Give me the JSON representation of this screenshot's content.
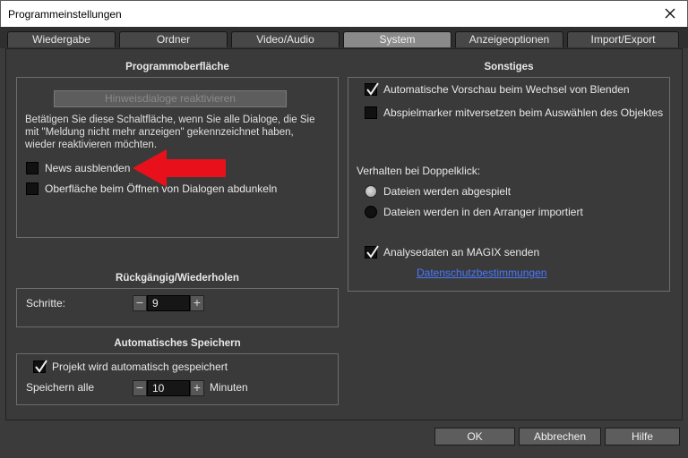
{
  "window": {
    "title": "Programmeinstellungen"
  },
  "tabs": [
    {
      "label": "Wiedergabe"
    },
    {
      "label": "Ordner"
    },
    {
      "label": "Video/Audio"
    },
    {
      "label": "System"
    },
    {
      "label": "Anzeigeoptionen"
    },
    {
      "label": "Import/Export"
    }
  ],
  "active_tab": "System",
  "programmoberflaeche": {
    "title": "Programmoberfläche",
    "reactivate_button": "Hinweisdialoge reaktivieren",
    "description_lines": [
      "Betätigen Sie diese Schaltfläche, wenn Sie alle Dialoge, die Sie",
      "mit \"Meldung nicht mehr anzeigen\" gekennzeichnet haben,",
      "wieder reaktivieren möchten."
    ],
    "news_ausblenden": {
      "label": "News ausblenden",
      "checked": false
    },
    "abdunkeln": {
      "label": "Oberfläche beim Öffnen von Dialogen abdunkeln",
      "checked": false
    }
  },
  "rueckgaengig": {
    "title": "Rückgängig/Wiederholen",
    "schritte_label": "Schritte:",
    "schritte_value": "9"
  },
  "autosave": {
    "title": "Automatisches Speichern",
    "checkbox": {
      "label": "Projekt wird automatisch gespeichert",
      "checked": true
    },
    "interval_label": "Speichern alle",
    "interval_value": "10",
    "unit": "Minuten"
  },
  "sonstiges": {
    "title": "Sonstiges",
    "auto_preview": {
      "label": "Automatische Vorschau beim Wechsel von Blenden",
      "checked": true
    },
    "playmarker": {
      "label": "Abspielmarker mitversetzen beim Auswählen des Objektes",
      "checked": false
    },
    "doubleclick_label": "Verhalten bei Doppelklick:",
    "radio_played": {
      "label": "Dateien werden abgespielt",
      "selected": true
    },
    "radio_arranger": {
      "label": "Dateien werden in den Arranger importiert",
      "selected": false
    },
    "analysis": {
      "label": "Analysedaten an MAGIX senden",
      "checked": true
    },
    "privacy_link": "Datenschutzbestimmungen"
  },
  "buttons": {
    "ok": "OK",
    "cancel": "Abbrechen",
    "help": "Hilfe"
  },
  "minus_glyph": "−",
  "plus_glyph": "+",
  "annotation": {
    "arrow_color": "#e8111b"
  }
}
